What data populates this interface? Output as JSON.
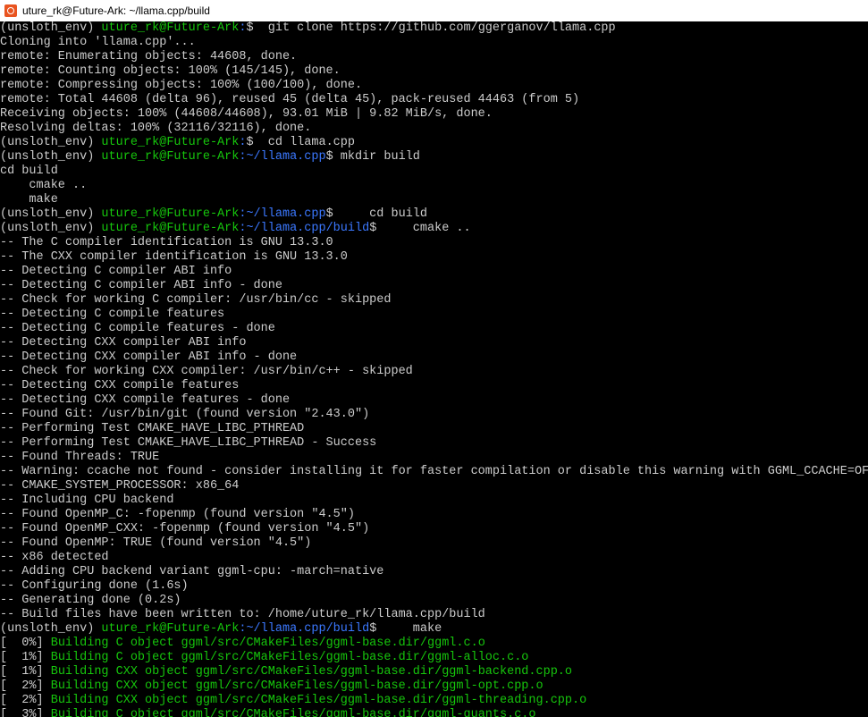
{
  "window": {
    "title": "uture_rk@Future-Ark: ~/llama.cpp/build"
  },
  "colors": {
    "prompt_user": "#16c60c",
    "prompt_path": "#3b78ff",
    "text": "#cccccc",
    "background": "#000000",
    "build_output": "#16c60c"
  },
  "terminal": {
    "lines": [
      [
        {
          "t": "(unsloth_env) "
        },
        {
          "t": "uture_rk@Future-Ark",
          "c": "g"
        },
        {
          "t": ":",
          "c": "b"
        },
        {
          "t": "$  git clone https://github.com/ggerganov/llama.cpp"
        }
      ],
      [
        {
          "t": "Cloning into 'llama.cpp'..."
        }
      ],
      [
        {
          "t": "remote: Enumerating objects: 44608, done."
        }
      ],
      [
        {
          "t": "remote: Counting objects: 100% (145/145), done."
        }
      ],
      [
        {
          "t": "remote: Compressing objects: 100% (100/100), done."
        }
      ],
      [
        {
          "t": "remote: Total 44608 (delta 96), reused 45 (delta 45), pack-reused 44463 (from 5)"
        }
      ],
      [
        {
          "t": "Receiving objects: 100% (44608/44608), 93.01 MiB | 9.82 MiB/s, done."
        }
      ],
      [
        {
          "t": "Resolving deltas: 100% (32116/32116), done."
        }
      ],
      [
        {
          "t": "(unsloth_env) "
        },
        {
          "t": "uture_rk@Future-Ark",
          "c": "g"
        },
        {
          "t": ":",
          "c": "b"
        },
        {
          "t": "$  cd llama.cpp"
        }
      ],
      [
        {
          "t": "(unsloth_env) "
        },
        {
          "t": "uture_rk@Future-Ark",
          "c": "g"
        },
        {
          "t": ":~/llama.cpp",
          "c": "b"
        },
        {
          "t": "$ mkdir build"
        }
      ],
      [
        {
          "t": "cd build"
        }
      ],
      [
        {
          "t": "    cmake .."
        }
      ],
      [
        {
          "t": "    make"
        }
      ],
      [
        {
          "t": "(unsloth_env) "
        },
        {
          "t": "uture_rk@Future-Ark",
          "c": "g"
        },
        {
          "t": ":~/llama.cpp",
          "c": "b"
        },
        {
          "t": "$     cd build"
        }
      ],
      [
        {
          "t": "(unsloth_env) "
        },
        {
          "t": "uture_rk@Future-Ark",
          "c": "g"
        },
        {
          "t": ":~/llama.cpp/build",
          "c": "b"
        },
        {
          "t": "$     cmake .."
        }
      ],
      [
        {
          "t": "-- The C compiler identification is GNU 13.3.0"
        }
      ],
      [
        {
          "t": "-- The CXX compiler identification is GNU 13.3.0"
        }
      ],
      [
        {
          "t": "-- Detecting C compiler ABI info"
        }
      ],
      [
        {
          "t": "-- Detecting C compiler ABI info - done"
        }
      ],
      [
        {
          "t": "-- Check for working C compiler: /usr/bin/cc - skipped"
        }
      ],
      [
        {
          "t": "-- Detecting C compile features"
        }
      ],
      [
        {
          "t": "-- Detecting C compile features - done"
        }
      ],
      [
        {
          "t": "-- Detecting CXX compiler ABI info"
        }
      ],
      [
        {
          "t": "-- Detecting CXX compiler ABI info - done"
        }
      ],
      [
        {
          "t": "-- Check for working CXX compiler: /usr/bin/c++ - skipped"
        }
      ],
      [
        {
          "t": "-- Detecting CXX compile features"
        }
      ],
      [
        {
          "t": "-- Detecting CXX compile features - done"
        }
      ],
      [
        {
          "t": "-- Found Git: /usr/bin/git (found version \"2.43.0\")"
        }
      ],
      [
        {
          "t": "-- Performing Test CMAKE_HAVE_LIBC_PTHREAD"
        }
      ],
      [
        {
          "t": "-- Performing Test CMAKE_HAVE_LIBC_PTHREAD - Success"
        }
      ],
      [
        {
          "t": "-- Found Threads: TRUE"
        }
      ],
      [
        {
          "t": "-- Warning: ccache not found - consider installing it for faster compilation or disable this warning with GGML_CCACHE=OFF"
        }
      ],
      [
        {
          "t": "-- CMAKE_SYSTEM_PROCESSOR: x86_64"
        }
      ],
      [
        {
          "t": "-- Including CPU backend"
        }
      ],
      [
        {
          "t": "-- Found OpenMP_C: -fopenmp (found version \"4.5\")"
        }
      ],
      [
        {
          "t": "-- Found OpenMP_CXX: -fopenmp (found version \"4.5\")"
        }
      ],
      [
        {
          "t": "-- Found OpenMP: TRUE (found version \"4.5\")"
        }
      ],
      [
        {
          "t": "-- x86 detected"
        }
      ],
      [
        {
          "t": "-- Adding CPU backend variant ggml-cpu: -march=native"
        }
      ],
      [
        {
          "t": "-- Configuring done (1.6s)"
        }
      ],
      [
        {
          "t": "-- Generating done (0.2s)"
        }
      ],
      [
        {
          "t": "-- Build files have been written to: /home/uture_rk/llama.cpp/build"
        }
      ],
      [
        {
          "t": "(unsloth_env) "
        },
        {
          "t": "uture_rk@Future-Ark",
          "c": "g"
        },
        {
          "t": ":~/llama.cpp/build",
          "c": "b"
        },
        {
          "t": "$     make"
        }
      ],
      [
        {
          "t": "[  0%] "
        },
        {
          "t": "Building C object ggml/src/CMakeFiles/ggml-base.dir/ggml.c.o",
          "c": "g"
        }
      ],
      [
        {
          "t": "[  1%] "
        },
        {
          "t": "Building C object ggml/src/CMakeFiles/ggml-base.dir/ggml-alloc.c.o",
          "c": "g"
        }
      ],
      [
        {
          "t": "[  1%] "
        },
        {
          "t": "Building CXX object ggml/src/CMakeFiles/ggml-base.dir/ggml-backend.cpp.o",
          "c": "g"
        }
      ],
      [
        {
          "t": "[  2%] "
        },
        {
          "t": "Building CXX object ggml/src/CMakeFiles/ggml-base.dir/ggml-opt.cpp.o",
          "c": "g"
        }
      ],
      [
        {
          "t": "[  2%] "
        },
        {
          "t": "Building CXX object ggml/src/CMakeFiles/ggml-base.dir/ggml-threading.cpp.o",
          "c": "g"
        }
      ],
      [
        {
          "t": "[  3%] "
        },
        {
          "t": "Building C object ggml/src/CMakeFiles/ggml-base.dir/ggml-quants.c.o",
          "c": "g"
        }
      ]
    ]
  }
}
